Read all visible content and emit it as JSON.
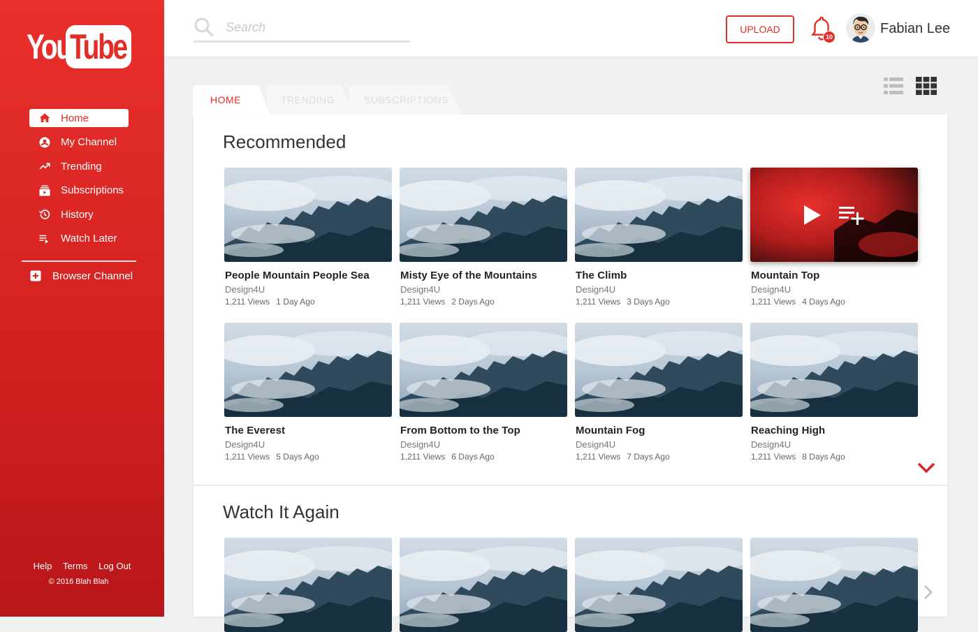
{
  "app": {
    "logo_you": "You",
    "logo_tube": "Tube"
  },
  "colors": {
    "brand": "#e52d27",
    "sidebar_top": "#e8302c",
    "sidebar_bottom": "#b8161a"
  },
  "sidebar": {
    "items": [
      {
        "label": "Home",
        "icon": "home-icon",
        "active": true
      },
      {
        "label": "My Channel",
        "icon": "account-circle-icon",
        "active": false
      },
      {
        "label": "Trending",
        "icon": "trending-up-icon",
        "active": false
      },
      {
        "label": "Subscriptions",
        "icon": "subscriptions-icon",
        "active": false
      },
      {
        "label": "History",
        "icon": "history-icon",
        "active": false
      },
      {
        "label": "Watch Later",
        "icon": "playlist-play-icon",
        "active": false
      }
    ],
    "browse_label": "Browser Channel",
    "footer_links": [
      "Help",
      "Terms",
      "Log Out"
    ],
    "copyright": "© 2016 Blah Blah"
  },
  "header": {
    "search_placeholder": "Search",
    "upload_label": "UPLOAD",
    "notification_count": "10",
    "user_name": "Fabian Lee"
  },
  "tabs": [
    "HOME",
    "TRENDING",
    "SUBSCRIPTIONS"
  ],
  "recommended": {
    "title": "Recommended",
    "videos": [
      {
        "title": "People Mountain People Sea",
        "channel": "Design4U",
        "views": "1,211 Views",
        "age": "1 Day Ago"
      },
      {
        "title": "Misty Eye of the Mountains",
        "channel": "Design4U",
        "views": "1,211 Views",
        "age": "2 Days Ago"
      },
      {
        "title": "The Climb",
        "channel": "Design4U",
        "views": "1,211 Views",
        "age": "3 Days Ago"
      },
      {
        "title": "Mountain Top",
        "channel": "Design4U",
        "views": "1,211 Views",
        "age": "4 Days Ago",
        "hovered": true
      },
      {
        "title": "The Everest",
        "channel": "Design4U",
        "views": "1,211 Views",
        "age": "5 Days Ago"
      },
      {
        "title": "From Bottom to the Top",
        "channel": "Design4U",
        "views": "1,211 Views",
        "age": "6 Days Ago"
      },
      {
        "title": "Mountain Fog",
        "channel": "Design4U",
        "views": "1,211 Views",
        "age": "7 Days Ago"
      },
      {
        "title": "Reaching High",
        "channel": "Design4U",
        "views": "1,211 Views",
        "age": "8 Days Ago"
      }
    ]
  },
  "watch_again": {
    "title": "Watch It Again"
  }
}
